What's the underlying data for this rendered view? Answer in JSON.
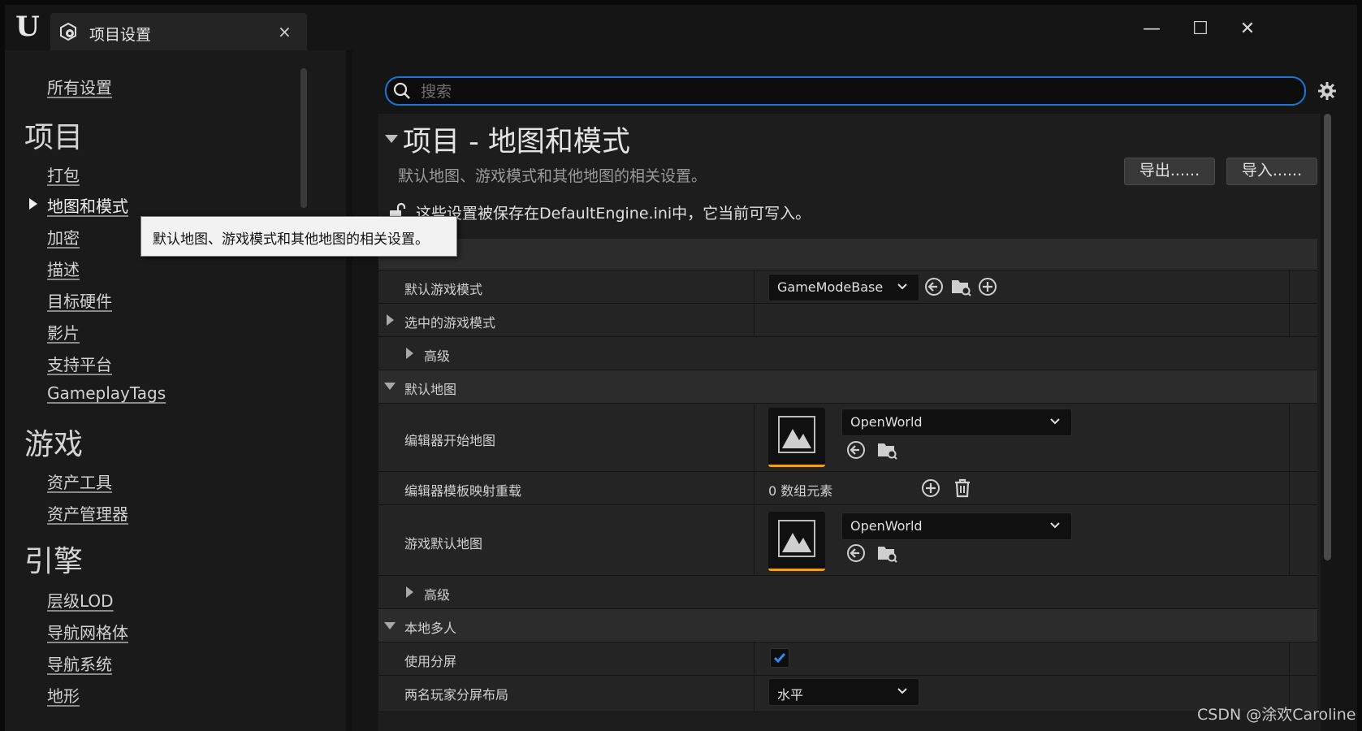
{
  "window": {
    "tab_title": "项目设置",
    "close_glyph": "×",
    "controls": {
      "minimize": "—",
      "maximize": "☐",
      "close": "✕"
    }
  },
  "sidebar": {
    "all_settings": "所有设置",
    "sections": [
      {
        "title": "项目",
        "items": [
          "打包",
          "地图和模式",
          "加密",
          "描述",
          "目标硬件",
          "影片",
          "支持平台",
          "GameplayTags"
        ]
      },
      {
        "title": "游戏",
        "items": [
          "资产工具",
          "资产管理器"
        ]
      },
      {
        "title": "引擎",
        "items": [
          "层级LOD",
          "导航网格体",
          "导航系统",
          "地形"
        ]
      }
    ],
    "selected": "地图和模式",
    "tooltip": "默认地图、游戏模式和其他地图的相关设置。"
  },
  "search": {
    "placeholder": "搜索",
    "value": ""
  },
  "header": {
    "title": "项目 - 地图和模式",
    "subtitle": "默认地图、游戏模式和其他地图的相关设置。",
    "export_label": "导出......",
    "import_label": "导入......",
    "save_note": "这些设置被保存在DefaultEngine.ini中，它当前可写入。"
  },
  "properties": {
    "default_game_mode": {
      "label": "默认游戏模式",
      "value": "GameModeBase"
    },
    "selected_game_mode": {
      "label": "选中的游戏模式"
    },
    "advanced_1": "高级",
    "default_maps": "默认地图",
    "editor_startup_map": {
      "label": "编辑器开始地图",
      "value": "OpenWorld"
    },
    "editor_template_override": {
      "label": "编辑器模板映射重载",
      "value": "0 数组元素"
    },
    "game_default_map": {
      "label": "游戏默认地图",
      "value": "OpenWorld"
    },
    "advanced_2": "高级",
    "local_multiplayer": "本地多人",
    "use_splitscreen": {
      "label": "使用分屏",
      "checked": true
    },
    "two_player_layout": {
      "label": "两名玩家分屏布局",
      "value": "水平"
    }
  },
  "watermark": "CSDN @涂欢Caroline",
  "colors": {
    "accent": "#1877d6",
    "thumb_border": "#f0a020",
    "checkbox_check": "#2a8cf0"
  }
}
